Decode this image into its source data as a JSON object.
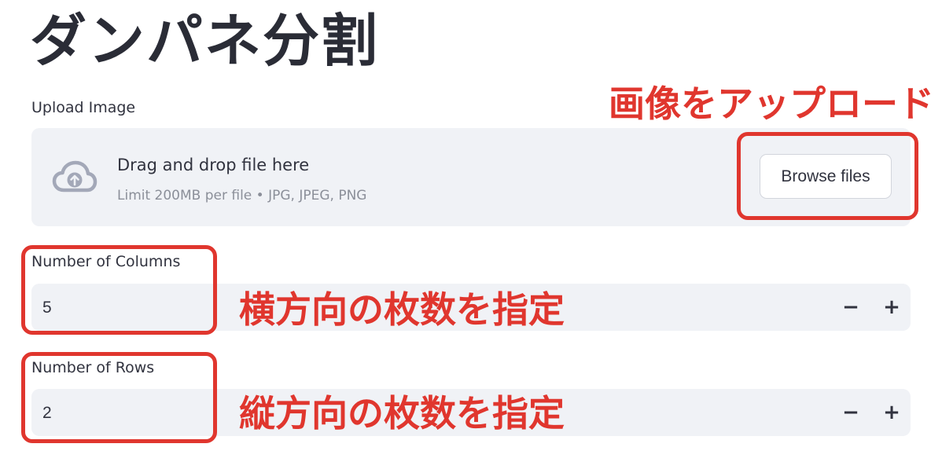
{
  "page": {
    "title": "ダンパネ分割"
  },
  "uploader": {
    "label": "Upload Image",
    "drop_text": "Drag and drop file here",
    "limit_text": "Limit 200MB per file • JPG, JPEG, PNG",
    "browse_label": "Browse files",
    "icon": "cloud-upload-icon"
  },
  "columns": {
    "label": "Number of Columns",
    "value": "5",
    "minus": "−",
    "plus": "+"
  },
  "rows": {
    "label": "Number of Rows",
    "value": "2",
    "minus": "−",
    "plus": "+"
  },
  "annotations": {
    "upload": "画像をアップロード",
    "columns": "横方向の枚数を指定",
    "rows": "縦方向の枚数を指定",
    "color": "#e0362e"
  }
}
